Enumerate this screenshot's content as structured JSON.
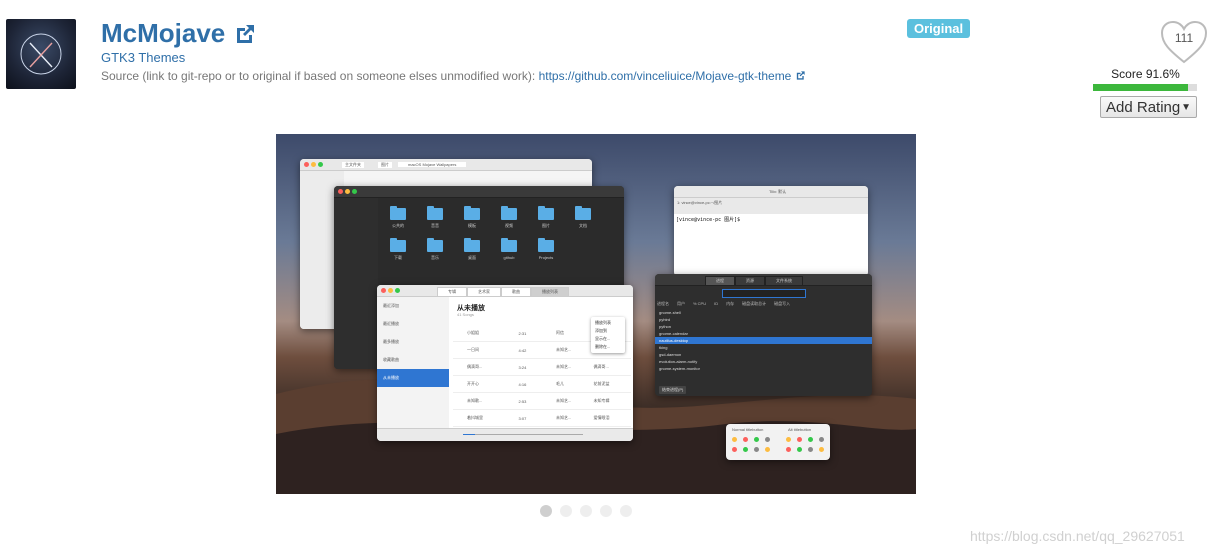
{
  "header": {
    "title": "McMojave",
    "category": "GTK3 Themes",
    "source_label": "Source (link to git-repo or to original if based on someone elses unmodified work):",
    "source_link": "https://github.com/vinceliuice/Mojave-gtk-theme",
    "badge": "Original"
  },
  "rating": {
    "likes": "111",
    "score_label": "Score 91.6%",
    "score": 91.6,
    "add_rating": "Add Rating",
    "add_rating_caret": "▼"
  },
  "carousel": {
    "count": 5,
    "active_index": 0
  },
  "screenshot": {
    "finder_tab": "主文件夹",
    "finder_tab2": "图片",
    "finder_path": "macOS Mojave Wallpapers",
    "terminal_title": "Tilix: 默认",
    "terminal_prompt": "[vince@vince-pc 图片]$",
    "terminal_path": "1: vince@vince-pc:~/图片",
    "music_title": "从未播放",
    "music_count": "41 Songs",
    "music_tabs": [
      "专辑",
      "艺术家",
      "歌曲",
      "播放列表"
    ],
    "music_sidebar": [
      "最近添加",
      "最近播放",
      "最多播放",
      "收藏歌曲",
      "从未播放"
    ],
    "music_rows": [
      {
        "name": "小姐姐",
        "time": "2:31",
        "artist": "阿信",
        "album": ""
      },
      {
        "name": "一日间",
        "time": "4:42",
        "artist": "未知艺...",
        "album": "未知专辑"
      },
      {
        "name": "偶滴哥...",
        "time": "3:24",
        "artist": "未知艺...",
        "album": "偶滴哥..."
      },
      {
        "name": "开开心",
        "time": "4:16",
        "artist": "毛儿",
        "album": "花前泥盆"
      },
      {
        "name": "未知歌...",
        "time": "2:53",
        "artist": "未知艺...",
        "album": "未知专辑"
      },
      {
        "name": "着抖城里",
        "time": "3:07",
        "artist": "未知艺...",
        "album": "爱情眼泪"
      }
    ],
    "folders": [
      "公共的",
      "音音",
      "模板",
      "视频",
      "图片",
      "文档",
      "下载",
      "音乐",
      "桌面",
      "github",
      "Projects"
    ],
    "sysmon_tabs": [
      "进程",
      "资源",
      "文件系统"
    ],
    "sysmon_cols": [
      "进程名",
      "用户",
      "% CPU",
      "ID",
      "内存",
      "磁盘读取总计",
      "磁盘写入"
    ],
    "sysmon_rows": [
      "gnome-shell",
      "pyhtrd",
      "python",
      "gnome-calendar",
      "nautilus-desktop",
      "tking",
      "gsd-daemon",
      "evolution-alarm-notify",
      "gnome-system-monitor"
    ],
    "sysmon_end_button": "结束进程(P)",
    "popup_items": [
      "播放列表",
      "添加到",
      "显示在...",
      "删除在..."
    ],
    "widget_labels": [
      "Normal titlebutton",
      "Alt titlebutton"
    ]
  }
}
